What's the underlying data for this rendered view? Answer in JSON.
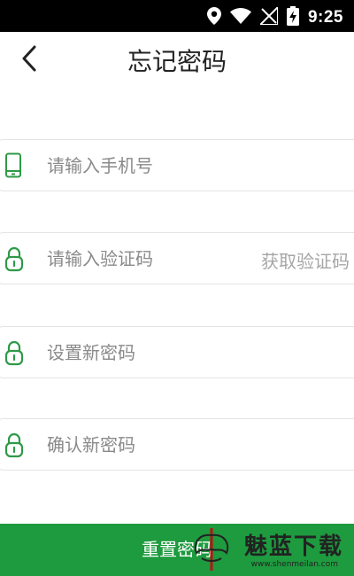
{
  "status_bar": {
    "time": "9:25",
    "icons": [
      "location-icon",
      "wifi-icon",
      "no-signal-icon",
      "battery-charging-icon"
    ]
  },
  "header": {
    "title": "忘记密码",
    "back_icon": "chevron-left-icon"
  },
  "form": {
    "phone": {
      "value": "",
      "placeholder": "请输入手机号",
      "icon": "phone-icon"
    },
    "code": {
      "value": "",
      "placeholder": "请输入验证码",
      "icon": "lock-icon",
      "action_label": "获取验证码"
    },
    "new_password": {
      "value": "",
      "placeholder": "设置新密码",
      "icon": "lock-icon"
    },
    "confirm_password": {
      "value": "",
      "placeholder": "确认新密码",
      "icon": "lock-icon"
    }
  },
  "submit_label": "重置密码",
  "watermark": {
    "text": "魅蓝下载",
    "url": "www.shenmeilan.com"
  },
  "colors": {
    "accent": "#1e9a3f",
    "status_bar": "#000000",
    "placeholder": "#8a8a8a",
    "link_disabled": "#a6a6a6"
  }
}
